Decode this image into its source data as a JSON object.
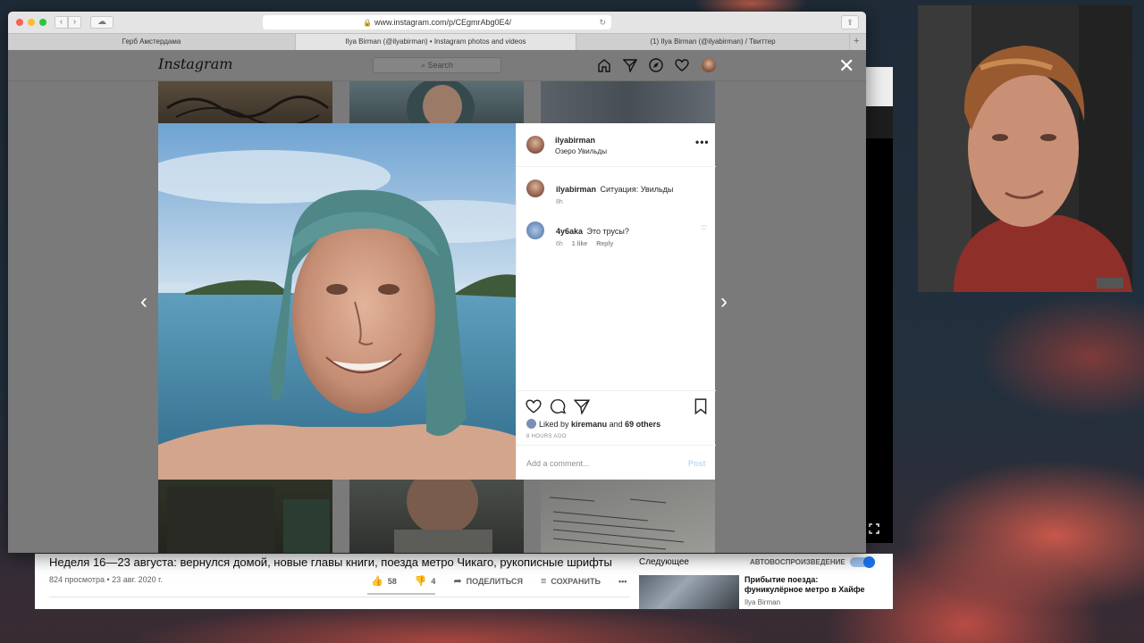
{
  "safari": {
    "url": "www.instagram.com/p/CEgmrAbg0E4/",
    "tabs": [
      {
        "label": "Герб Амстердама",
        "active": false
      },
      {
        "label": "Ilya Birman (@ilyabirman) • Instagram photos and videos",
        "active": true
      },
      {
        "label": "(1) Ilya Birman (@ilyabirman) / Твиттер",
        "active": false
      }
    ],
    "add_tab": "+"
  },
  "instagram": {
    "logo": "Instagram",
    "search_placeholder": "Search",
    "nav_icons": [
      "home-icon",
      "direct-icon",
      "explore-icon",
      "activity-heart-icon",
      "profile-avatar"
    ],
    "close": "✕",
    "prev_arrow": "‹",
    "next_arrow": "›",
    "post": {
      "username": "ilyabirman",
      "location": "Озеро Увильды",
      "more": "•••",
      "caption": {
        "user": "ilyabirman",
        "text": "Ситуация: Увильды",
        "time": "8h"
      },
      "comments": [
        {
          "user": "4у6aka",
          "text": "Это трусы?",
          "time": "6h",
          "likes": "1 like",
          "reply": "Reply"
        }
      ],
      "liked_by_prefix": "Liked by",
      "liked_by_user": "kiremanu",
      "liked_by_and": "and",
      "liked_by_others": "69 others",
      "time_ago": "8 HOURS AGO",
      "comment_placeholder": "Add a comment...",
      "post_button": "Post"
    }
  },
  "youtube": {
    "video_title": "Неделя 16—23 августа: вернулся домой, новые главы книги, поезда метро Чикаго, рукописные шрифты",
    "meta": "824 просмотра • 23 авг. 2020 г.",
    "likes": "58",
    "dislikes": "4",
    "share": "ПОДЕЛИТЬСЯ",
    "save": "СОХРАНИТЬ",
    "more": "•••",
    "up_next": "Следующее",
    "autoplay": "АВТОВОСПРОИЗВЕДЕНИЕ",
    "recommended": {
      "title": "Прибытие поезда: фуникулёрное метро в Хайфе",
      "channel": "Ilya Birman"
    }
  }
}
